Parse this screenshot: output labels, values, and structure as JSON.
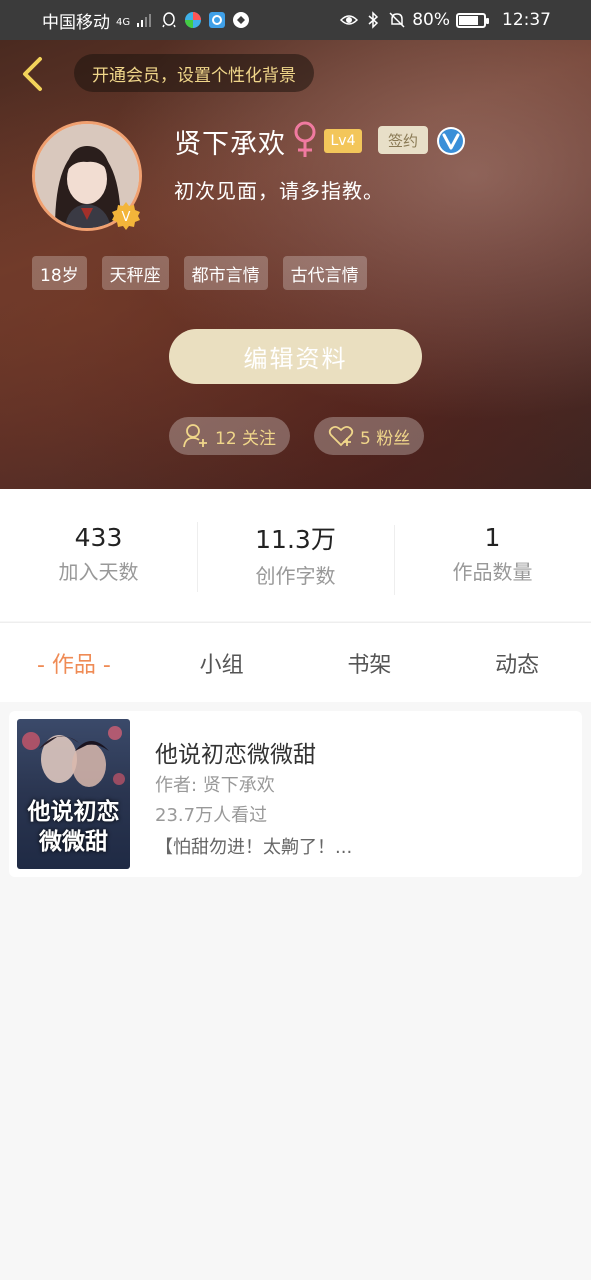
{
  "status_bar": {
    "carrier": "中国移动",
    "network": "4G",
    "battery": "80%",
    "battery_level": 0.8,
    "time": "12:37"
  },
  "header": {
    "vip_banner": "开通会员，设置个性化背景",
    "username": "贤下承欢",
    "level": "Lv4",
    "signed_badge": "签约",
    "bio": "初次见面，请多指教。",
    "tags": [
      "18岁",
      "天秤座",
      "都市言情",
      "古代言情"
    ],
    "edit_button": "编辑资料",
    "follow_label": "12 关注",
    "fans_label": "5 粉丝",
    "colors": {
      "accent_gold": "#f0d68a",
      "avatar_ring": "#f0a070"
    }
  },
  "stats": [
    {
      "value": "433",
      "label": "加入天数"
    },
    {
      "value": "11.3万",
      "label": "创作字数"
    },
    {
      "value": "1",
      "label": "作品数量"
    }
  ],
  "tabs": [
    {
      "label": "- 作品 -",
      "active": true
    },
    {
      "label": "小组",
      "active": false
    },
    {
      "label": "书架",
      "active": false
    },
    {
      "label": "动态",
      "active": false
    }
  ],
  "books": [
    {
      "cover_title": "他说初恋微微甜",
      "title": "他说初恋微微甜",
      "author": "作者: 贤下承欢",
      "views": "23.7万人看过",
      "description": "【怕甜勿进！太齁了！..."
    }
  ]
}
